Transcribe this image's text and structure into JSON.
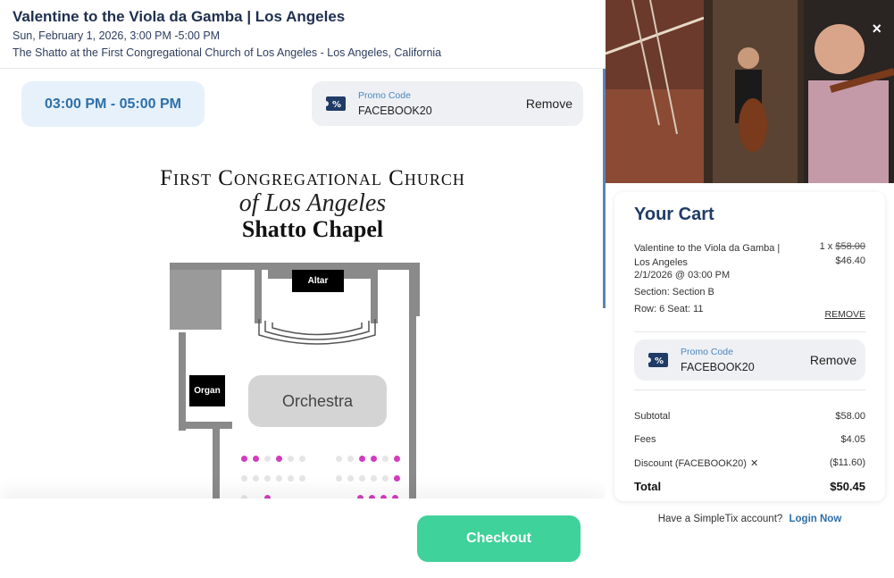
{
  "event": {
    "title": "Valentine to the Viola da Gamba | Los Angeles",
    "date": "Sun, February 1, 2026, 3:00 PM -5:00 PM",
    "venue": "The Shatto at the First Congregational Church of Los Angeles - Los Angeles, California"
  },
  "time_slot": "03:00 PM - 05:00 PM",
  "promo": {
    "label": "Promo Code",
    "code": "FACEBOOK20",
    "remove": "Remove"
  },
  "seatmap": {
    "title_line1": "First Congregational Church",
    "title_line2": "of Los Angeles",
    "chapel": "Shatto Chapel",
    "altar": "Altar",
    "organ": "Organ",
    "orchestra": "Orchestra"
  },
  "checkout_label": "Checkout",
  "close_icon": "×",
  "cart": {
    "title": "Your Cart",
    "item": {
      "name": "Valentine to the Viola da Gamba | Los Angeles",
      "datetime": "2/1/2026 @ 03:00 PM",
      "section": "Section: Section B",
      "row_seat": "Row: 6 Seat: 11",
      "qty": "1 x ",
      "original_price": "$58.00",
      "price": "$46.40",
      "remove": "REMOVE"
    },
    "promo": {
      "label": "Promo Code",
      "code": "FACEBOOK20",
      "remove": "Remove"
    },
    "subtotal_label": "Subtotal",
    "subtotal": "$58.00",
    "fees_label": "Fees",
    "fees": "$4.05",
    "discount_label": "Discount (FACEBOOK20)",
    "discount": "($11.60)",
    "total_label": "Total",
    "total": "$50.45"
  },
  "account": {
    "prompt": "Have a SimpleTix account?",
    "link": "Login Now"
  },
  "colors": {
    "accent_blue": "#2e6fa7",
    "checkout_green": "#3fd29a",
    "seat_pink": "#d23cbf",
    "cart_title": "#1f3b66"
  }
}
